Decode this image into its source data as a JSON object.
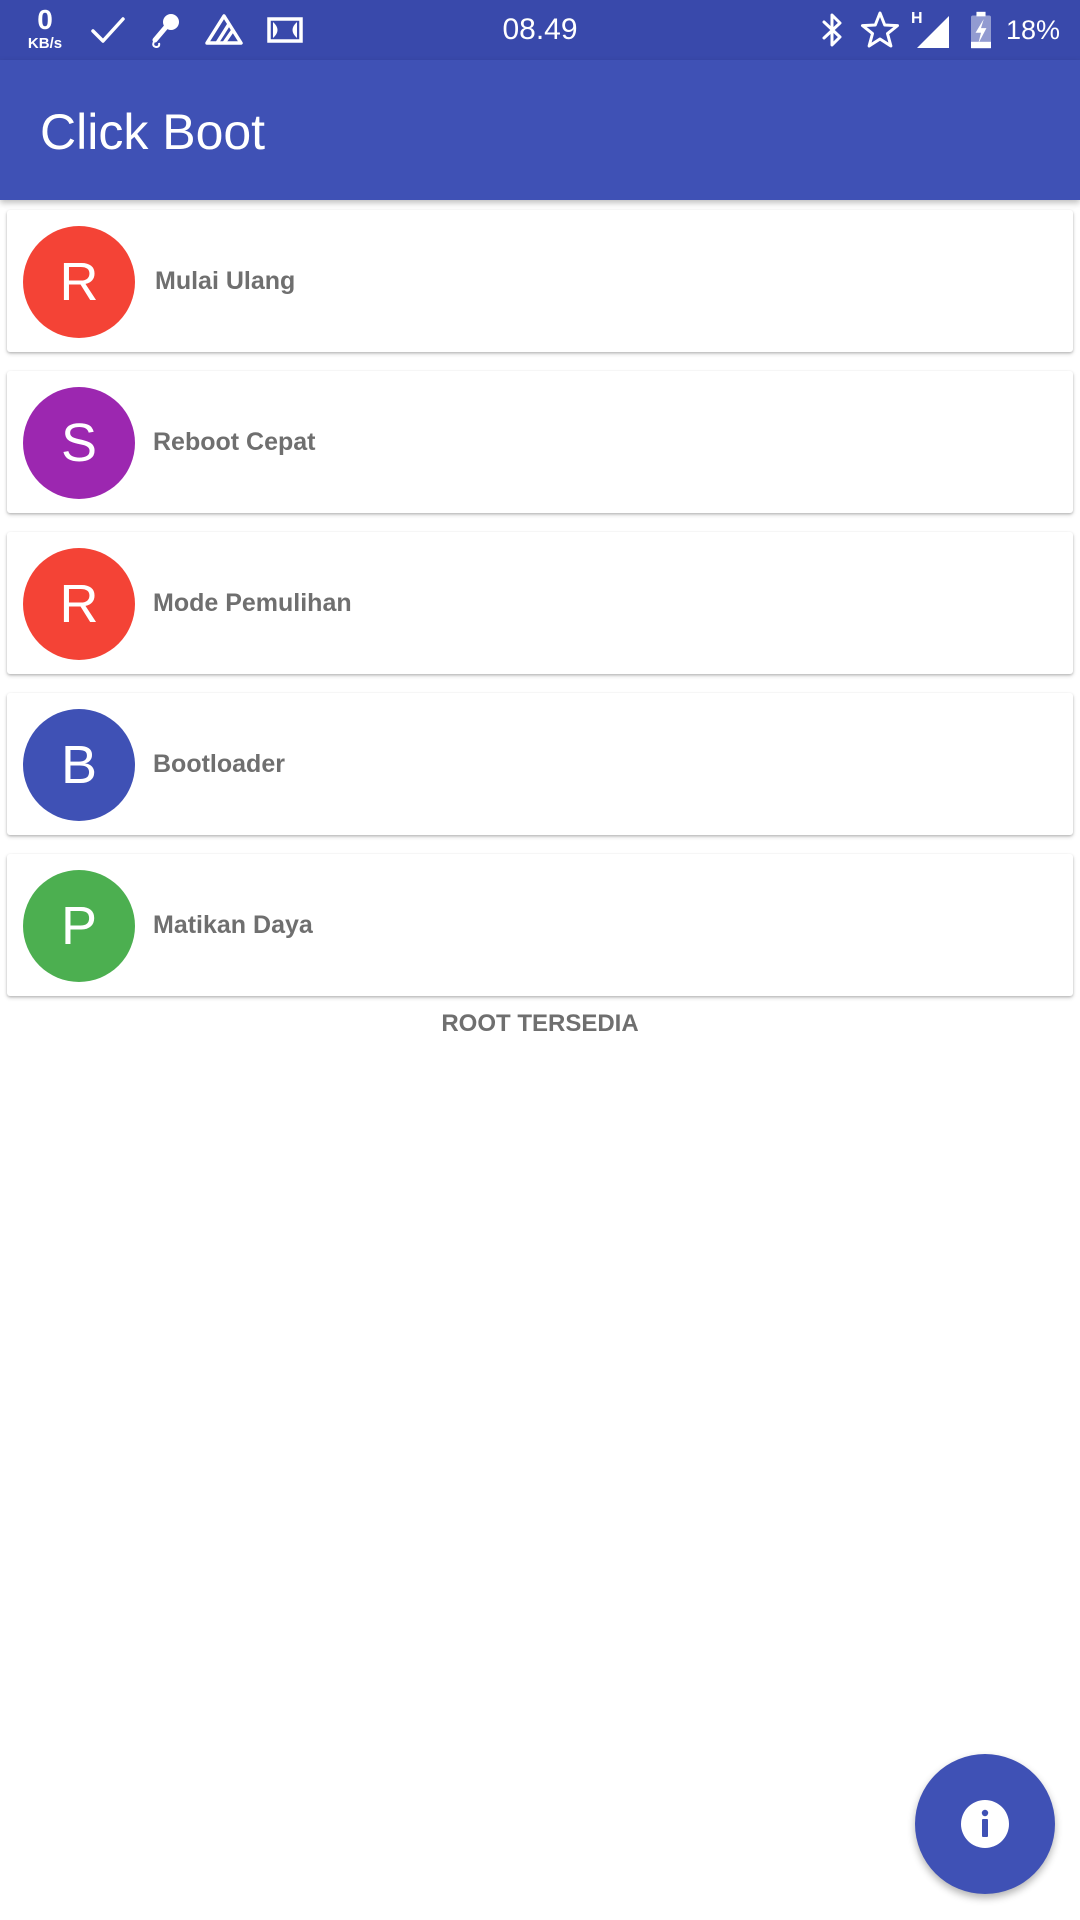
{
  "status_bar": {
    "net_speed_value": "0",
    "net_speed_unit": "KB/s",
    "time": "08.49",
    "network_type": "H",
    "battery_percent": "18%",
    "icons": [
      "check-icon",
      "microphone-icon",
      "tasker-icon",
      "dolby-icon",
      "bluetooth-icon",
      "star-icon",
      "signal-icon",
      "battery-charging-icon"
    ]
  },
  "app_bar": {
    "title": "Click Boot",
    "color": "#3f51b5"
  },
  "items": [
    {
      "initial": "R",
      "label": "Mulai Ulang",
      "color": "#f44336"
    },
    {
      "initial": "S",
      "label": "Reboot Cepat",
      "color": "#9c27b0"
    },
    {
      "initial": "R",
      "label": "Mode Pemulihan",
      "color": "#f44336"
    },
    {
      "initial": "B",
      "label": "Bootloader",
      "color": "#3f51b5"
    },
    {
      "initial": "P",
      "label": "Matikan Daya",
      "color": "#4caf50"
    }
  ],
  "root_status": "ROOT TERSEDIA",
  "fab": {
    "icon": "info-icon",
    "color": "#3f51b5"
  }
}
